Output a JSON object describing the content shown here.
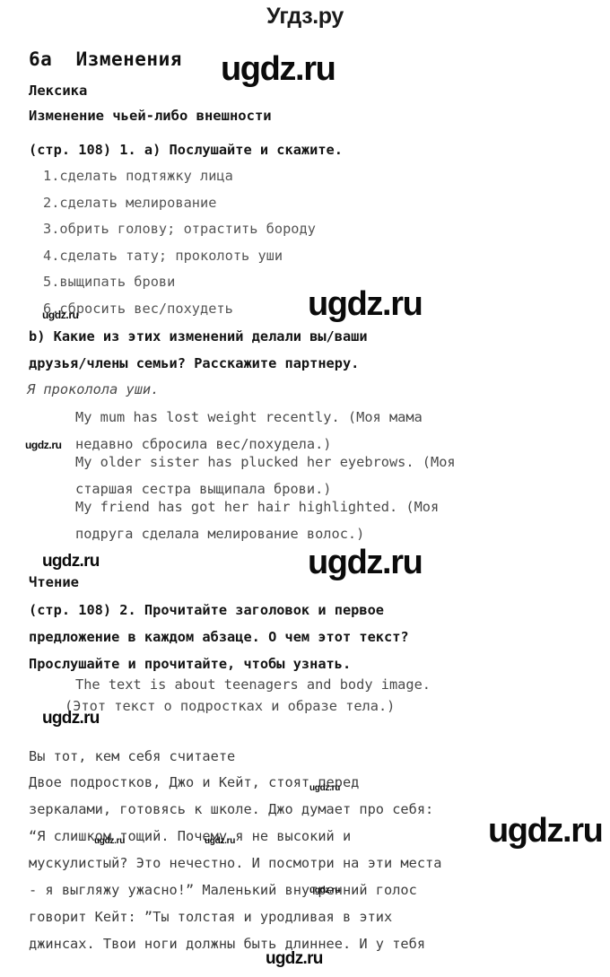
{
  "site": {
    "header_logo": "Угдз.ру",
    "watermark_text": "ugdz.ru"
  },
  "lesson": {
    "title": "6a  Изменения",
    "section_vocabulary": "Лексика",
    "topic": "Изменение чьей-либо внешности",
    "task1_heading": "(стр. 108) 1. a) Послушайте и скажите.",
    "task1_items": [
      {
        "num": "1.",
        "text": "сделать подтяжку лица"
      },
      {
        "num": "2.",
        "text": "сделать мелирование"
      },
      {
        "num": "3.",
        "text": "обрить голову; отрастить бороду"
      },
      {
        "num": "4.",
        "text": "сделать тату; проколоть уши"
      },
      {
        "num": "5.",
        "text": "выщипать брови"
      },
      {
        "num": "6.",
        "text": "сбросить вес/похудеть"
      }
    ],
    "task1b_heading": "b) Какие из этих изменений делали вы/ваши\nдрузья/члены семьи? Расскажите партнеру.",
    "task1b_example": "Я проколола уши.",
    "task1b_answers": [
      "My mum has lost weight recently. (Моя мама\nнедавно сбросила вес/похудела.)",
      "My older sister has plucked her eyebrows. (Моя\nстаршая сестра выщипала брови.)",
      "My friend has got her hair highlighted. (Моя\nподруга сделала мелирование волос.)"
    ],
    "section_reading": "Чтение",
    "task2_heading": "(стр. 108) 2. Прочитайте заголовок и первое\nпредложение в каждом абзаце. О чем этот текст?\nПрослушайте и прочитайте, чтобы узнать.",
    "task2_answer_en": "The text is about teenagers and body image.",
    "task2_answer_ru": "(Этот текст о подростках и образе тела.)",
    "text_title": "Вы тот, кем себя считаете",
    "text_body": "    Двое подростков, Джо и Кейт, стоят перед\nзеркалами, готовясь к школе. Джо думает про себя:\n“Я слишком тощий. Почему я не высокий и\nмускулистый? Это нечестно. И посмотри на эти места\n- я выгляжу ужасно!” Маленький внутренний голос\nговорит Кейт: ”Ты толстая и уродливая в этих\nджинсах. Твои ноги должны быть длиннее. И у тебя"
  },
  "colors": {
    "page_background": "#ffffff",
    "body_text": "#4a4a4a",
    "heading_text": "#141414",
    "watermark": "#0b0b0b"
  }
}
